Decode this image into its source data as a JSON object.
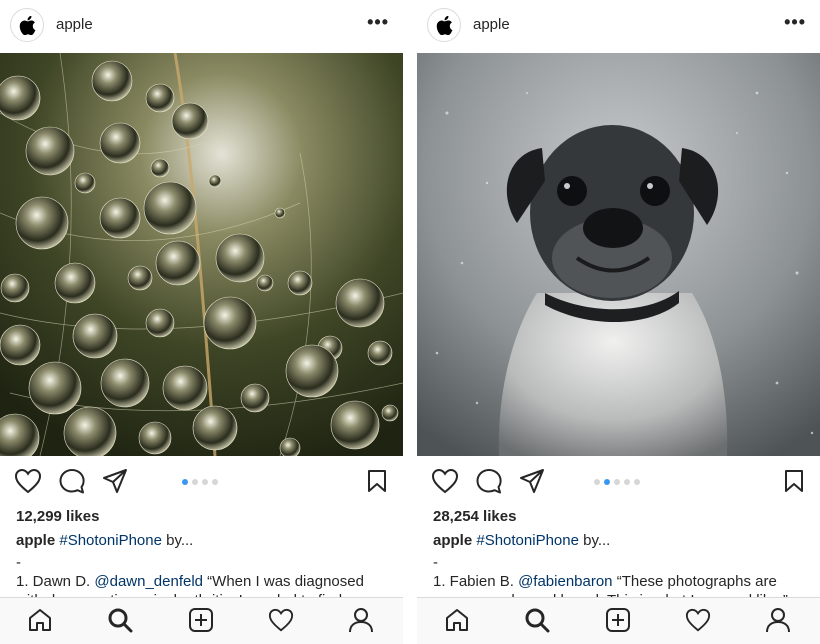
{
  "posts": [
    {
      "username": "apple",
      "more_label": "•••",
      "likes": "12,299 likes",
      "caption_user": "apple",
      "caption_tag": "#ShotoniPhone",
      "caption_more": " by...",
      "dash": "-",
      "body_line1_prefix": "1. Dawn D. ",
      "body_line1_mention": "@dawn_denfeld",
      "body_line1_rest": " “When I was diagnosed",
      "body_line2": "with degenerative spinal arthritis, I needed to find a",
      "carousel_count": 4,
      "carousel_active": 0,
      "photo_icon": "water-droplets-photo"
    },
    {
      "username": "apple",
      "more_label": "•••",
      "likes": "28,254 likes",
      "caption_user": "apple",
      "caption_tag": "#ShotoniPhone",
      "caption_more": " by...",
      "dash": "-",
      "body_line1_prefix": "1. Fabien B. ",
      "body_line1_mention": "@fabienbaron",
      "body_line1_rest": " “These photographs are",
      "body_line2": "my personal mood board. This is what I see and like.”",
      "carousel_count": 5,
      "carousel_active": 1,
      "photo_icon": "pug-dog-photo"
    }
  ],
  "nav": [
    "home-icon",
    "search-icon",
    "new-post-icon",
    "activity-icon",
    "profile-icon"
  ],
  "colors": {
    "accent": "#3897f0",
    "mention": "#003569",
    "text": "#262626"
  }
}
